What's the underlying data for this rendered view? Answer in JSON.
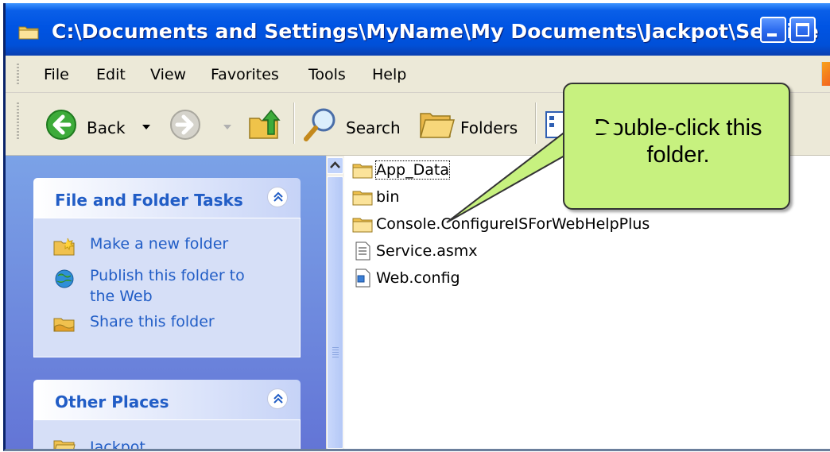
{
  "window": {
    "title": "C:\\Documents and Settings\\MyName\\My Documents\\Jackpot\\Service"
  },
  "menu": [
    "File",
    "Edit",
    "View",
    "Favorites",
    "Tools",
    "Help"
  ],
  "toolbar": {
    "back_label": "Back",
    "search_label": "Search",
    "folders_label": "Folders"
  },
  "taskpane": {
    "file_tasks": {
      "title": "File and Folder Tasks",
      "items": [
        {
          "label": "Make a new folder",
          "icon": "new-folder-icon"
        },
        {
          "label_line1": "Publish this folder to",
          "label_line2": "the Web",
          "icon": "publish-web-icon"
        },
        {
          "label": "Share this folder",
          "icon": "share-folder-icon"
        }
      ]
    },
    "other_places": {
      "title": "Other Places",
      "items": [
        {
          "label": "Jackpot",
          "icon": "folder-icon"
        }
      ]
    }
  },
  "files": [
    {
      "name": "App_Data",
      "type": "folder"
    },
    {
      "name": "bin",
      "type": "folder"
    },
    {
      "name": "Console.ConfigureISForWebHelpPlus",
      "type": "folder"
    },
    {
      "name": "Service.asmx",
      "type": "asmx-file"
    },
    {
      "name": "Web.config",
      "type": "config-file"
    }
  ],
  "callout": {
    "line1": "Double-click this",
    "line2": "folder."
  },
  "colors": {
    "titlebar": "#0054e3",
    "taskpane": "#6375d6",
    "task_link": "#215dc6",
    "callout_fill": "#c7f17f"
  }
}
